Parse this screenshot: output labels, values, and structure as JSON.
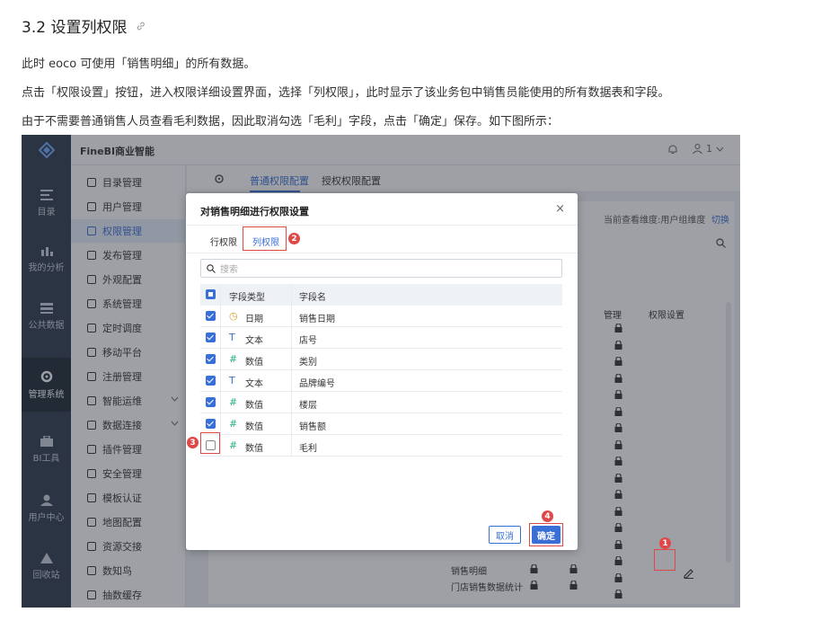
{
  "doc": {
    "title": "3.2 设置列权限",
    "p1": "此时 eoco 可使用「销售明细」的所有数据。",
    "p2": "点击「权限设置」按钮，进入权限详细设置界面，选择「列权限」，此时显示了该业务包中销售员能使用的所有数据表和字段。",
    "p3": "由于不需要普通销售人员查看毛利数据，因此取消勾选「毛利」字段，点击「确定」保存。如下图所示："
  },
  "app": {
    "name": "FineBI商业智能",
    "user_label": "1",
    "iconbar": [
      "目录",
      "我的分析",
      "公共数据",
      "管理系统",
      "BI工具",
      "用户中心",
      "回收站"
    ],
    "menu": [
      "目录管理",
      "用户管理",
      "权限管理",
      "发布管理",
      "外观配置",
      "系统管理",
      "定时调度",
      "移动平台",
      "注册管理",
      "智能运维",
      "数据连接",
      "插件管理",
      "安全管理",
      "模板认证",
      "地图配置",
      "资源交接",
      "数知鸟",
      "抽数缓存"
    ],
    "tabs": [
      "普通权限配置",
      "授权权限配置"
    ],
    "dim_text": "当前查看维度:用户组维度",
    "dim_switch": "切换",
    "col_manage": "管理",
    "col_perm": "权限设置",
    "tree_rows": [
      "销售明细",
      "门店销售数据统计"
    ]
  },
  "dialog": {
    "title": "对销售明细进行权限设置",
    "close": "×",
    "tabs": [
      "行权限",
      "列权限"
    ],
    "search_placeholder": "搜索",
    "col_type": "字段类型",
    "col_name": "字段名",
    "rows": [
      {
        "type": "日期",
        "name": "销售日期",
        "icon": "clock-icon",
        "checked": true
      },
      {
        "type": "文本",
        "name": "店号",
        "icon": "text-icon",
        "checked": true
      },
      {
        "type": "数值",
        "name": "类别",
        "icon": "hash-icon",
        "checked": true
      },
      {
        "type": "文本",
        "name": "品牌编号",
        "icon": "text-icon",
        "checked": true
      },
      {
        "type": "数值",
        "name": "楼层",
        "icon": "hash-icon",
        "checked": true
      },
      {
        "type": "数值",
        "name": "销售额",
        "icon": "hash-icon",
        "checked": true
      },
      {
        "type": "数值",
        "name": "毛利",
        "icon": "hash-icon",
        "checked": false
      }
    ],
    "cancel": "取消",
    "ok": "确定"
  },
  "badges": [
    "1",
    "2",
    "3",
    "4"
  ],
  "colors": {
    "accent": "#3a6fd8",
    "marker": "#e04848",
    "sidebar": "#2f3b4c"
  }
}
